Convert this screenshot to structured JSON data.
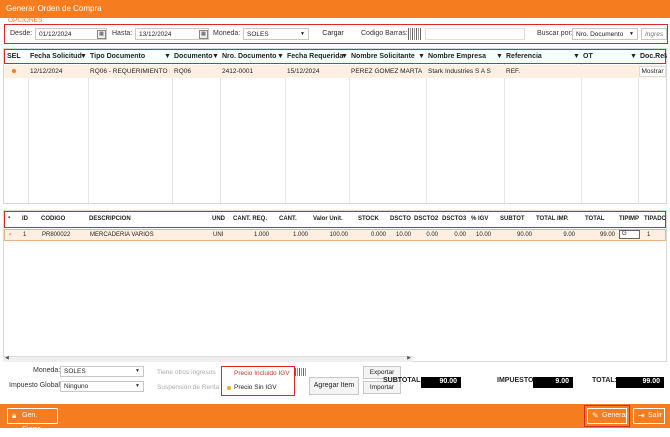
{
  "window": {
    "title": "Generar Orden de Compra"
  },
  "options_label": "OPCIONES",
  "filter": {
    "desde_label": "Desde:",
    "desde_value": "01/12/2024",
    "hasta_label": "Hasta:",
    "hasta_value": "13/12/2024",
    "moneda_label": "Moneda:",
    "moneda_value": "SOLES",
    "cargar_label": "Cargar",
    "codigo_barras_label": "Codigo Barras:",
    "buscar_por_label": "Buscar por:",
    "buscar_por_value": "Nro. Documento",
    "search_placeholder": "Ingrese el"
  },
  "requests_table": {
    "columns": [
      "SEL",
      "Fecha Solicitud",
      "Tipo Documento",
      "Documento",
      "Nro. Documento",
      "Fecha Requerida",
      "Nombre Solicitante",
      "Nombre Empresa",
      "Referencia",
      "OT",
      "Doc.Relacionado"
    ],
    "rows": [
      {
        "fecha_solicitud": "12/12/2024",
        "tipo_documento": "RQ06 - REQUERIMIENTO PR",
        "documento": "RQ06",
        "nro_documento": "2412-0001",
        "fecha_requerida": "15/12/2024",
        "nombre_solicitante": "PEREZ GOMEZ MARTA",
        "nombre_empresa": "Stark Industries S A S",
        "referencia": "REF.",
        "ot": "",
        "doc_relacionado": "Mostrar"
      }
    ]
  },
  "items_table": {
    "columns": [
      "ID",
      "CODIGO",
      "DESCRIPCION",
      "UND",
      "CANT. REQ.",
      "CANT.",
      "Valor Unit.",
      "STOCK",
      "DSCTO",
      "DSCTO2",
      "DSCTO3",
      "% IGV",
      "SUBTOT",
      "TOTAL IMP.",
      "TOTAL",
      "TIPIMP",
      "TIPADC"
    ],
    "rows": [
      {
        "id": "1",
        "codigo": "PR800022",
        "descripcion": "MERCADERIA VARIOS",
        "und": "UNI",
        "cant_req": "1.000",
        "cant": "1.000",
        "valor_unit": "100.00",
        "stock": "0.000",
        "dscto": "10.00",
        "dscto2": "0.00",
        "dscto3": "0.00",
        "igv": "10.00",
        "subtot": "90.00",
        "total_imp": "9.00",
        "total": "99.00",
        "tipimp": "G",
        "tipadc": "1"
      }
    ]
  },
  "bottom": {
    "moneda_label": "Moneda:",
    "moneda_value": "SOLES",
    "impuesto_label": "Impuesto Global :",
    "impuesto_value": "Ninguno",
    "otros_ingresos_label": "Tiene otros ingresos",
    "suspension_label": "Suspensión de Renta",
    "precio_incluido_label": "Precio Incluido IGV",
    "precio_sin_label": "Precio Sin IGV",
    "agregar_label": "Agregar Item",
    "exportar_label": "Exportar",
    "importar_label": "Importar",
    "subtotal_label": "SUBTOTAL :",
    "subtotal_value": "90.00",
    "impuesto_total_label": "IMPUESTO:",
    "impuesto_total_value": "9.00",
    "total_label": "TOTAL:",
    "total_value": "99.00"
  },
  "footer": {
    "gen_cierre_label": "Gen. Cierre",
    "generar_label": "Generar",
    "salir_label": "Salir"
  },
  "colors": {
    "accent": "#f57c1f",
    "highlight": "#d42a2a",
    "selected_row": "#fdf0e2"
  }
}
